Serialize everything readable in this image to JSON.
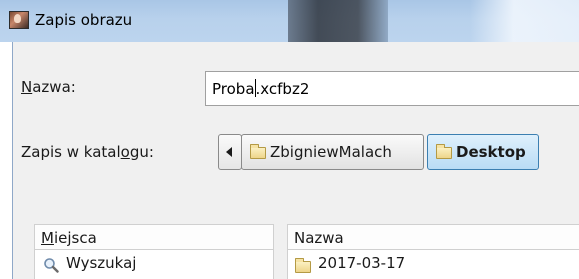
{
  "window": {
    "title": "Zapis obrazu"
  },
  "name_field": {
    "label": "Nazwa:",
    "value_before_caret": "Proba",
    "value_after_caret": ".xcfbz2"
  },
  "folder_field": {
    "label": "Zapis w katalogu:",
    "breadcrumbs": [
      {
        "label": "ZbigniewMalach",
        "icon": "folder-icon",
        "active": false
      },
      {
        "label": "Desktop",
        "icon": "folder-icon",
        "active": true
      }
    ]
  },
  "places_pane": {
    "header": "Miejsca",
    "items": [
      {
        "label": "Wyszukaj",
        "icon": "search-icon"
      }
    ]
  },
  "files_pane": {
    "header": "Nazwa",
    "items": [
      {
        "label": "2017-03-17",
        "icon": "folder-icon"
      }
    ]
  },
  "colors": {
    "title_bar": "#b8d1ec",
    "active_crumb": "#b9dcf5",
    "dialog_bg": "#f0f0f0"
  }
}
